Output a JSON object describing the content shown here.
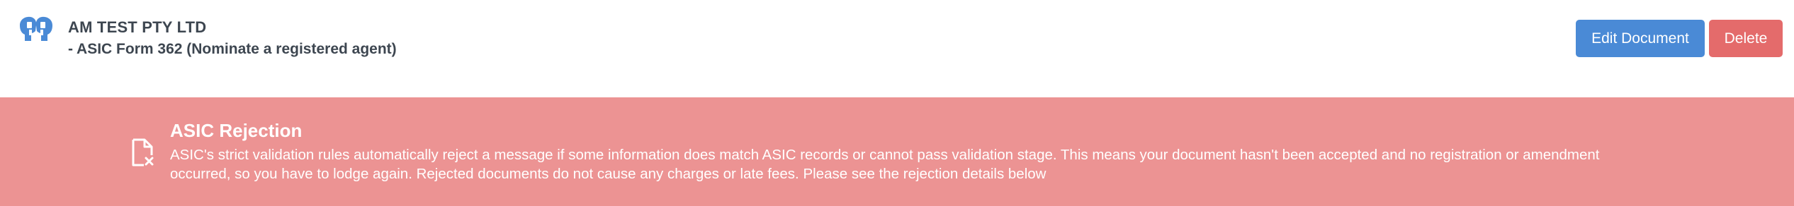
{
  "header": {
    "company_name": "AM TEST PTY LTD",
    "form_subtitle": "- ASIC Form 362 (Nominate a registered agent)",
    "logo_icon": "two-heads-logo-icon"
  },
  "actions": {
    "edit_label": "Edit Document",
    "delete_label": "Delete"
  },
  "alert": {
    "icon": "document-rejected-icon",
    "title": "ASIC Rejection",
    "message": "ASIC's strict validation rules automatically reject a message if some information does match ASIC records or cannot pass validation stage. This means your document hasn't been accepted and no registration or amendment occurred, so you have to lodge again. Rejected documents do not cause any charges or late fees. Please see the rejection details below"
  },
  "colors": {
    "logo_blue": "#4a8ad6",
    "edit_button": "#4a8ad6",
    "delete_button": "#e46b6b",
    "alert_background": "#ec9393",
    "header_text": "#3d4650"
  }
}
